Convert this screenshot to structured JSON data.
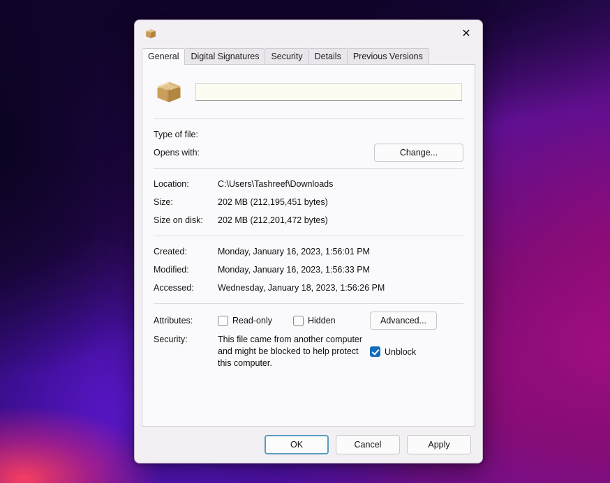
{
  "desktop": {
    "wallpaper_colors": {
      "deep_navy": "#14062a",
      "purple": "#5f1199",
      "magenta": "#b0108a",
      "pink_streak": "#ff4060"
    }
  },
  "dialog": {
    "title": "",
    "title_icon": "archive-box-icon",
    "close_label": "✕",
    "tabs": [
      {
        "label": "General",
        "active": true
      },
      {
        "label": "Digital Signatures",
        "active": false
      },
      {
        "label": "Security",
        "active": false
      },
      {
        "label": "Details",
        "active": false
      },
      {
        "label": "Previous Versions",
        "active": false
      }
    ],
    "general": {
      "file_icon": "archive-box-icon",
      "filename_value": "",
      "filename_placeholder": "",
      "type_of_file": {
        "label": "Type of file:",
        "value": ""
      },
      "opens_with": {
        "label": "Opens with:",
        "value": "",
        "change_button": "Change..."
      },
      "location": {
        "label": "Location:",
        "value": "C:\\Users\\Tashreef\\Downloads"
      },
      "size": {
        "label": "Size:",
        "value": "202 MB (212,195,451 bytes)"
      },
      "size_on_disk": {
        "label": "Size on disk:",
        "value": "202 MB (212,201,472 bytes)"
      },
      "created": {
        "label": "Created:",
        "value": "Monday, January 16, 2023, 1:56:01 PM"
      },
      "modified": {
        "label": "Modified:",
        "value": "Monday, January 16, 2023, 1:56:33 PM"
      },
      "accessed": {
        "label": "Accessed:",
        "value": "Wednesday, January 18, 2023, 1:56:26 PM"
      },
      "attributes": {
        "label": "Attributes:",
        "read_only": {
          "label": "Read-only",
          "checked": false
        },
        "hidden": {
          "label": "Hidden",
          "checked": false
        },
        "advanced_button": "Advanced..."
      },
      "security": {
        "label": "Security:",
        "message": "This file came from another computer and might be blocked to help protect this computer.",
        "unblock": {
          "label": "Unblock",
          "checked": true
        }
      }
    },
    "footer": {
      "ok": "OK",
      "cancel": "Cancel",
      "apply": "Apply"
    },
    "accent_color": "#0f6cbd",
    "default_button_border": "#5b9bbf"
  }
}
